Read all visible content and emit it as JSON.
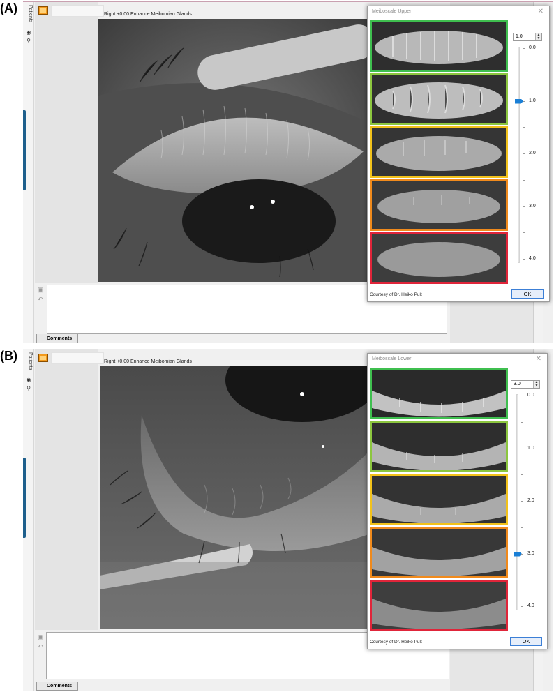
{
  "panel_a": {
    "letter": "(A)",
    "sidebar_tab": "Patients",
    "header": "Right +0.00 Enhance Meibomian Glands",
    "comments_tab": "Comments",
    "dialog": {
      "title": "Meiboscale Upper",
      "spin_value": "1.0",
      "slider_value": 1.0,
      "ticks": [
        "0.0",
        "1.0",
        "2.0",
        "3.0",
        "4.0"
      ],
      "courtesy": "Courtesy of Dr. Heiko Pult",
      "ok_label": "OK"
    }
  },
  "panel_b": {
    "letter": "(B)",
    "sidebar_tab": "Patients",
    "header": "Right +0.00 Enhance Meibomian Glands",
    "comments_tab": "Comments",
    "dialog": {
      "title": "Meiboscale Lower",
      "spin_value": "3.0",
      "slider_value": 3.0,
      "ticks": [
        "0.0",
        "1.0",
        "2.0",
        "3.0",
        "4.0"
      ],
      "courtesy": "Courtesy of Dr. Heiko Pult",
      "ok_label": "OK"
    }
  },
  "grade_colors": [
    "#3fbf4f",
    "#8cc63f",
    "#f2c21b",
    "#f08a1c",
    "#e0253a"
  ],
  "icons": {
    "sidebar_person": "person-icon",
    "sidebar_eye": "eye-icon",
    "sidebar_key": "key-icon",
    "film": "film-icon",
    "save": "save-icon",
    "undo": "undo-icon",
    "close": "close-icon"
  }
}
